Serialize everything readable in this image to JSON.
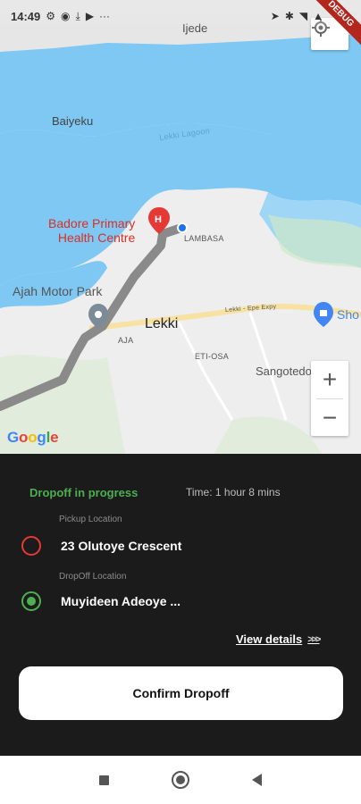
{
  "status_bar": {
    "time": "14:49",
    "left_icons": [
      "settings-icon",
      "location-chrome-icon",
      "download-icon",
      "youtube-icon",
      "more-dots-icon"
    ],
    "right_icons": [
      "location-arrow-icon",
      "bluetooth-icon",
      "wifi-icon",
      "signal-icon",
      "battery-icon"
    ],
    "debug_label": "DEBUG"
  },
  "map": {
    "labels": {
      "ijede": "Ijede",
      "baiyeku": "Baiyeku",
      "lagoon": "Lekki Lagoon",
      "hospital": "Badore Primary\nHealth Centre",
      "lambasa": "LAMBASA",
      "motor_park": "Ajah Motor Park",
      "lekki": "Lekki",
      "aja": "AJA",
      "expressway": "Lekki - Epe Expy",
      "eti_osa": "ETI-OSA",
      "sangotedo": "Sangotedo",
      "shop": "Sho"
    },
    "google_logo": [
      "G",
      "o",
      "o",
      "g",
      "l",
      "e"
    ],
    "zoom_in": "+",
    "zoom_out": "−",
    "colors": {
      "water": "#7ec8f3",
      "land": "#eeeeee",
      "route": "#8a8a8a",
      "road": "#f7e2a3"
    }
  },
  "trip": {
    "status": "Dropoff in progress",
    "time": "Time: 1 hour 8 mins",
    "pickup_caption": "Pickup Location",
    "pickup_value": "23 Olutoye Crescent",
    "dropoff_caption": "DropOff Location",
    "dropoff_value": "Muyideen Adeoye ...",
    "view_details": "View details",
    "view_details_chevrons": ">>>",
    "confirm_label": "Confirm Dropoff",
    "colors": {
      "accent_green": "#4caf50",
      "pickup_red": "#e53935"
    }
  },
  "nav_bar": {
    "buttons": [
      "recents-square-icon",
      "home-circle-icon",
      "back-triangle-icon"
    ]
  }
}
